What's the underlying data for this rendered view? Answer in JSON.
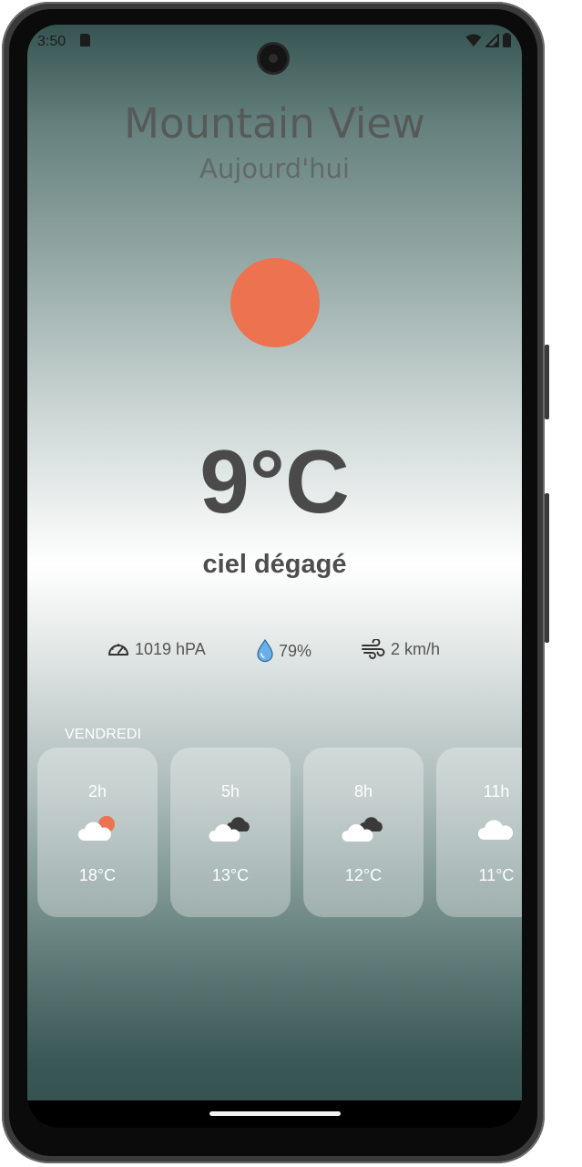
{
  "status_bar": {
    "time": "3:50",
    "icons": [
      "sd-card-icon",
      "wifi-icon",
      "signal-icon",
      "battery-icon"
    ]
  },
  "weather": {
    "city": "Mountain View",
    "subtitle": "Aujourd'hui",
    "icon": "sun-icon",
    "sun_color": "#ec7250",
    "temperature": "9°C",
    "condition": "ciel dégagé"
  },
  "details": {
    "pressure": {
      "icon": "gauge-icon",
      "value": "1019 hPA"
    },
    "humidity": {
      "icon": "water-drop-icon",
      "value": "79%",
      "color": "#6ab0e6"
    },
    "wind": {
      "icon": "wind-icon",
      "value": "2 km/h"
    }
  },
  "forecast": {
    "day_label": "VENDREDI",
    "hours": [
      {
        "hour": "2h",
        "icon": "cloud-sun-icon",
        "temp": "18°C"
      },
      {
        "hour": "5h",
        "icon": "cloudy-icon",
        "temp": "13°C"
      },
      {
        "hour": "8h",
        "icon": "cloudy-icon",
        "temp": "12°C"
      },
      {
        "hour": "11h",
        "icon": "cloud-icon",
        "temp": "11°C"
      }
    ]
  }
}
